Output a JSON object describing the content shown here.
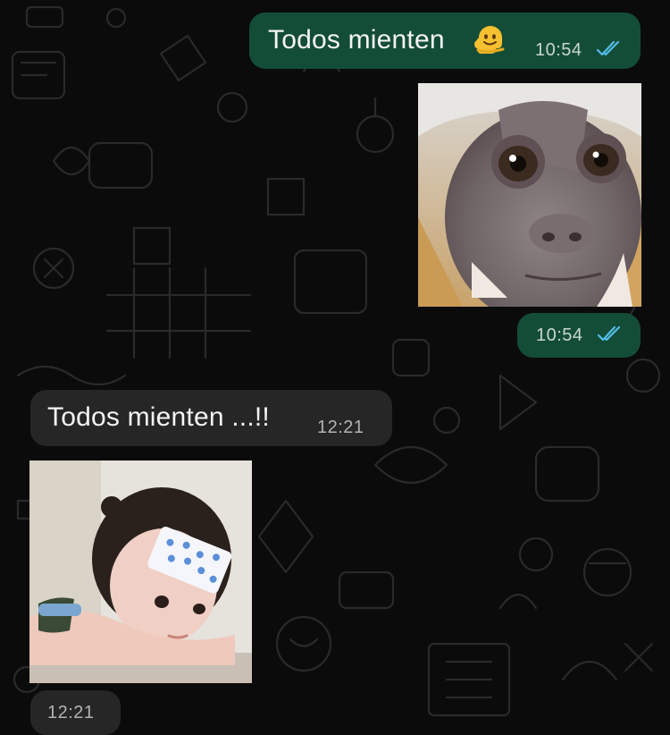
{
  "messages": [
    {
      "direction": "outgoing",
      "type": "text",
      "text": "Todos mienten",
      "emoji": "melting-face",
      "time": "10:54",
      "status": "read"
    },
    {
      "direction": "outgoing",
      "type": "sticker",
      "sticker": "capuchin-monkey-face",
      "time": "10:54",
      "status": "read"
    },
    {
      "direction": "incoming",
      "type": "text",
      "text": "Todos mienten ...!!",
      "time": "12:21"
    },
    {
      "direction": "incoming",
      "type": "sticker",
      "sticker": "girl-with-forehead-patch",
      "time": "12:21"
    }
  ],
  "colors": {
    "background": "#0b0b0b",
    "outgoing_bubble": "#144d37",
    "incoming_bubble": "#262626",
    "read_ticks": "#53bdeb"
  }
}
